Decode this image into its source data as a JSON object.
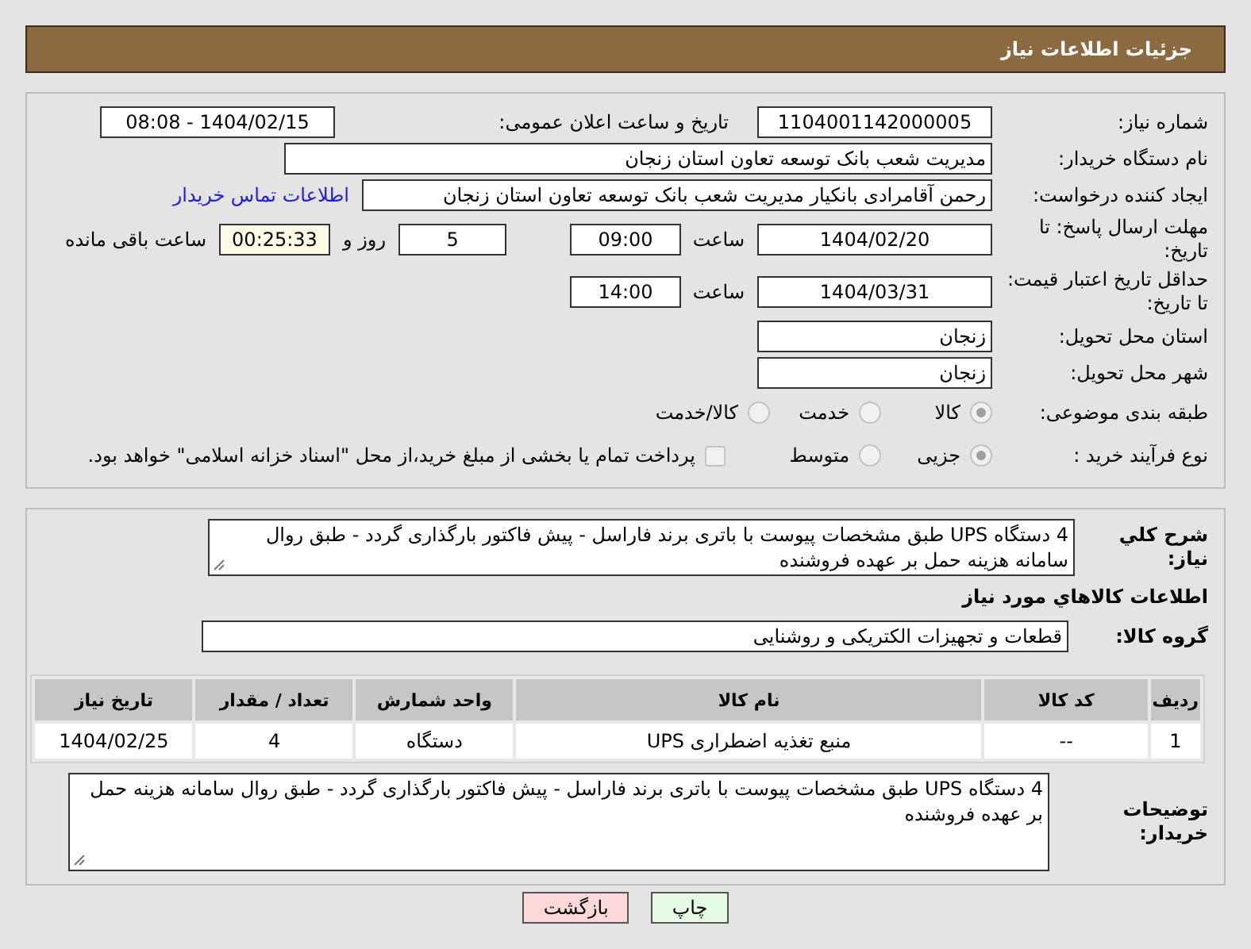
{
  "header": {
    "title": "جزئیات اطلاعات نیاز"
  },
  "need_number": {
    "label": "شماره نیاز:",
    "value": "1104001142000005"
  },
  "announce": {
    "label": "تاریخ و ساعت اعلان عمومی:",
    "value": "1404/02/15 - 08:08"
  },
  "buyer_org": {
    "label": "نام دستگاه خریدار:",
    "value": "مدیریت شعب بانک توسعه تعاون استان زنجان"
  },
  "requester": {
    "label": "ایجاد کننده درخواست:",
    "value": "رحمن آقامرادی بانکیار مدیریت شعب بانک توسعه تعاون استان زنجان",
    "link": "اطلاعات تماس خریدار"
  },
  "reply_deadline": {
    "label": "مهلت ارسال پاسخ: تا تاریخ:",
    "date": "1404/02/20",
    "time_label": "ساعت",
    "time": "09:00",
    "days": "5",
    "days_label": "روز و",
    "remaining": "00:25:33",
    "remaining_label": "ساعت باقی مانده"
  },
  "price_validity": {
    "label": "حداقل تاریخ اعتبار قیمت: تا تاریخ:",
    "date": "1404/03/31",
    "time_label": "ساعت",
    "time": "14:00"
  },
  "province": {
    "label": "استان محل تحویل:",
    "value": "زنجان"
  },
  "city": {
    "label": "شهر محل تحویل:",
    "value": "زنجان"
  },
  "category": {
    "label": "طبقه بندی موضوعی:",
    "options": [
      {
        "label": "کالا",
        "selected": true
      },
      {
        "label": "خدمت",
        "selected": false
      },
      {
        "label": "کالا/خدمت",
        "selected": false
      }
    ]
  },
  "process": {
    "label": "نوع فرآیند خرید :",
    "options": [
      {
        "label": "جزیی",
        "selected": true
      },
      {
        "label": "متوسط",
        "selected": false
      }
    ],
    "payment": {
      "label": "پرداخت تمام یا بخشی از مبلغ خرید،از محل \"اسناد خزانه اسلامی\" خواهد بود.",
      "checked": false
    }
  },
  "description": {
    "label": "شرح کلي نیاز:",
    "value": "4 دستگاه UPS طبق مشخصات پیوست با باتری برند فاراسل - پیش فاکتور بارگذاری گردد - طبق روال سامانه هزینه حمل بر عهده فروشنده"
  },
  "goods_heading": "اطلاعات کالاهاي مورد نیاز",
  "goods_group": {
    "label": "گروه کالا:",
    "value": "قطعات و تجهیزات الکتریکی و روشنایی"
  },
  "table": {
    "columns": [
      "ردیف",
      "کد کالا",
      "نام کالا",
      "واحد شمارش",
      "تعداد / مقدار",
      "تاریخ نیاز"
    ],
    "rows": [
      [
        "1",
        "--",
        "منبع تغذیه اضطراری UPS",
        "دستگاه",
        "4",
        "1404/02/25"
      ]
    ]
  },
  "buyer_notes": {
    "label": "توضیحات خریدار:",
    "value": "4 دستگاه UPS طبق مشخصات پیوست با باتری برند فاراسل - پیش فاکتور بارگذاری گردد - طبق روال سامانه هزینه حمل بر عهده فروشنده"
  },
  "buttons": [
    {
      "label": "چاپ",
      "kind": "print"
    },
    {
      "label": "بازگشت",
      "kind": "back"
    }
  ]
}
